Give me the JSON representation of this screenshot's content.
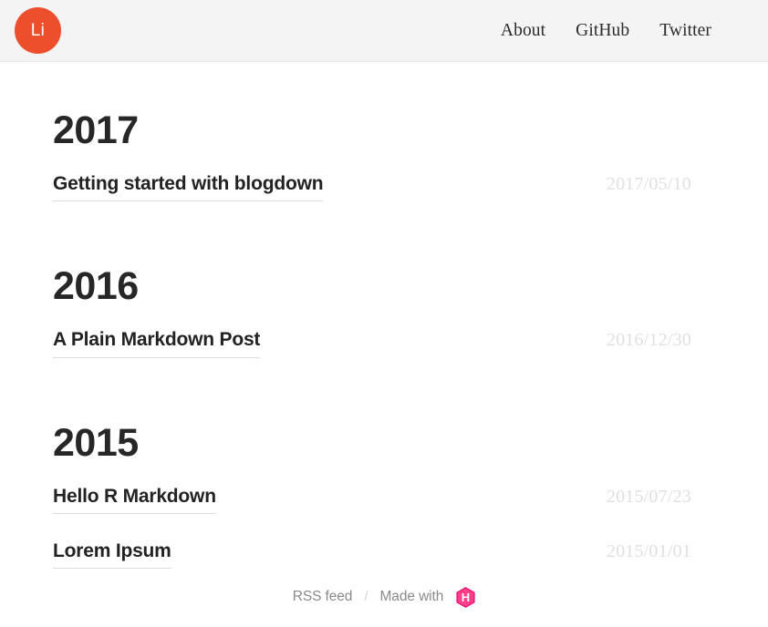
{
  "header": {
    "logo_text": "Li",
    "logo_color": "#ed4f2c",
    "nav": [
      {
        "label": "About"
      },
      {
        "label": "GitHub"
      },
      {
        "label": "Twitter"
      }
    ]
  },
  "archive": {
    "groups": [
      {
        "year": "2017",
        "posts": [
          {
            "title": "Getting started with blogdown",
            "date": "2017/05/10"
          }
        ]
      },
      {
        "year": "2016",
        "posts": [
          {
            "title": "A Plain Markdown Post",
            "date": "2016/12/30"
          }
        ]
      },
      {
        "year": "2015",
        "posts": [
          {
            "title": "Hello R Markdown",
            "date": "2015/07/23"
          },
          {
            "title": "Lorem Ipsum",
            "date": "2015/01/01"
          }
        ]
      }
    ]
  },
  "footer": {
    "rss_label": "RSS feed",
    "separator": "/",
    "made_with_label": "Made with",
    "hugo_icon_letter": "H",
    "hugo_color": "#ff4088"
  }
}
